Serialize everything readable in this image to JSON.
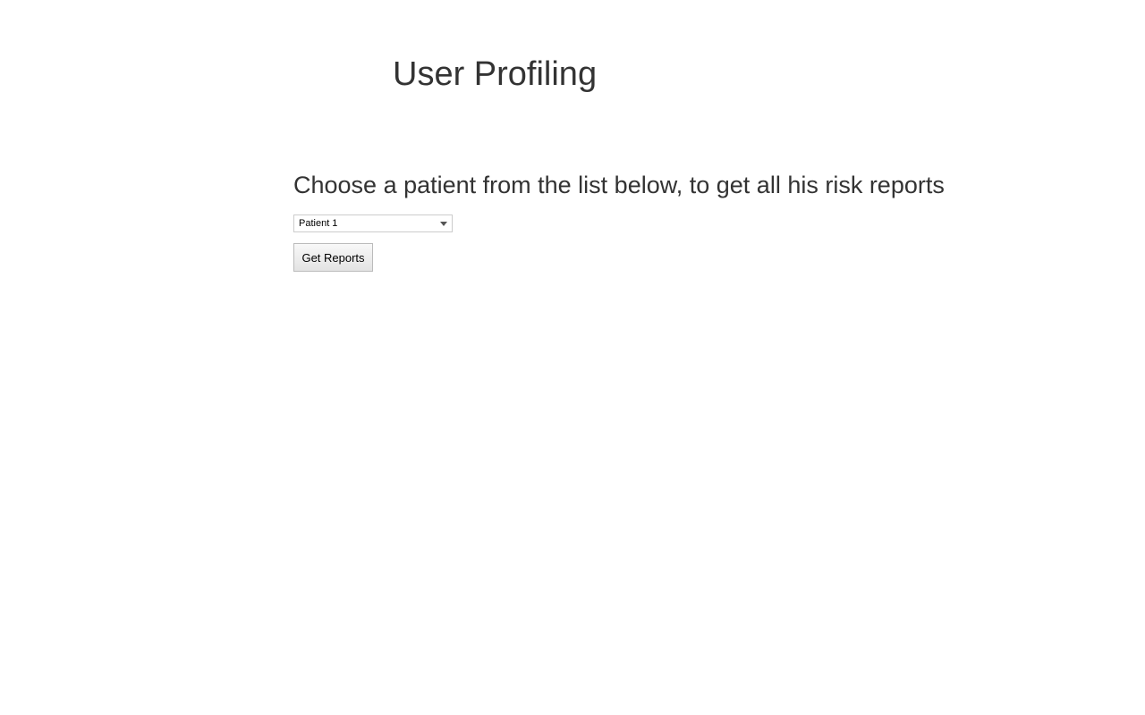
{
  "header": {
    "title": "User Profiling"
  },
  "main": {
    "prompt": "Choose a patient from the list below, to get all his risk reports",
    "patient_select": {
      "selected": "Patient 1"
    },
    "get_reports_label": "Get Reports"
  }
}
